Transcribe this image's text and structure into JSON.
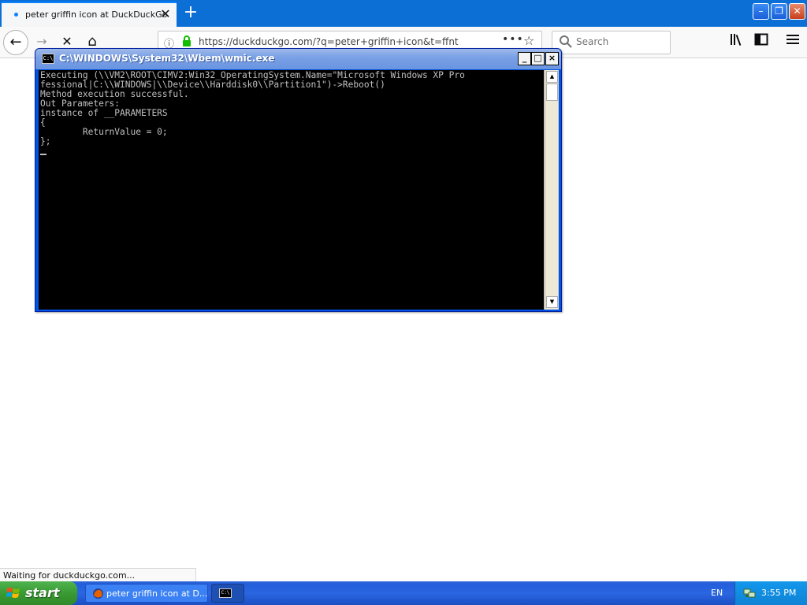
{
  "browser": {
    "tab": {
      "title": "peter griffin icon at DuckDuckGo",
      "close": "✕"
    },
    "new_tab": "+",
    "window_buttons": {
      "minimize": "–",
      "maximize": "❐",
      "close": "✕"
    },
    "nav": {
      "back": "←",
      "forward": "→",
      "stop": "✕",
      "home": "⌂"
    },
    "url": "https://duckduckgo.com/?q=peter+griffin+icon&t=ffnt",
    "url_menu": "•••",
    "bookmark": "☆",
    "search_placeholder": "Search",
    "status": "Waiting for duckduckgo.com...",
    "colors": {
      "tab_strip": "#0c6fd6",
      "accent": "#0a84ff",
      "lock": "#12bc00"
    }
  },
  "console": {
    "title": "C:\\WINDOWS\\System32\\Wbem\\wmic.exe",
    "icon_text": "C:\\",
    "buttons": {
      "minimize": "_",
      "maximize": "□",
      "close": "×"
    },
    "lines": [
      "Executing (\\\\VM2\\ROOT\\CIMV2:Win32_OperatingSystem.Name=\"Microsoft Windows XP Pro",
      "fessional|C:\\\\WINDOWS|\\\\Device\\\\Harddisk0\\\\Partition1\")->Reboot()",
      "Method execution successful.",
      "Out Parameters:",
      "instance of __PARAMETERS",
      "{",
      "        ReturnValue = 0;",
      "};"
    ],
    "scroll_up": "▲",
    "scroll_down": "▼"
  },
  "taskbar": {
    "start_label": "start",
    "items": [
      {
        "label": "peter griffin icon at D..."
      },
      {
        "label": ""
      }
    ],
    "language": "EN",
    "clock": "3:55 PM"
  }
}
